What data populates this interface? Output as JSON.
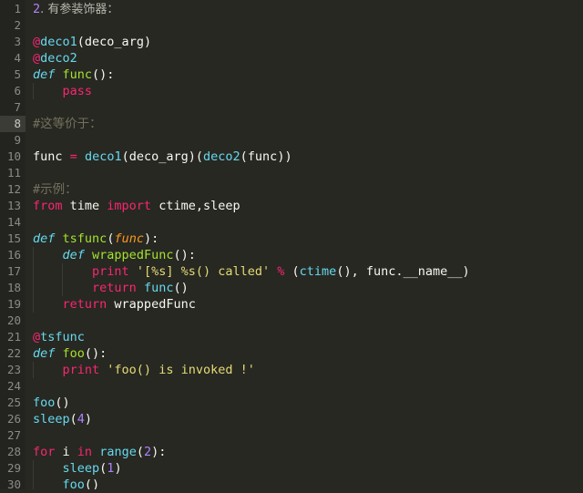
{
  "editor": {
    "name": "code-editor",
    "theme": "monokai-dark",
    "language": "python",
    "colors": {
      "background": "#272822",
      "gutter_background": "#232420",
      "gutter_text": "#8a8b85",
      "active_line_gutter_background": "#3b3c35",
      "keyword": "#f92672",
      "definition": "#66d9ef",
      "function_name": "#a6e22e",
      "parameter": "#fd971f",
      "number": "#ae81ff",
      "string": "#e6db74",
      "comment": "#75715e",
      "plain_text": "#f8f8f2",
      "indent_guide": "#3a3b34"
    },
    "active_line": 8,
    "first_line": 1,
    "last_line": 30,
    "total_visible_lines": 30
  },
  "gutter": {
    "line_numbers": [
      "1",
      "2",
      "3",
      "4",
      "5",
      "6",
      "7",
      "8",
      "9",
      "10",
      "11",
      "12",
      "13",
      "14",
      "15",
      "16",
      "17",
      "18",
      "19",
      "20",
      "21",
      "22",
      "23",
      "24",
      "25",
      "26",
      "27",
      "28",
      "29",
      "30"
    ]
  },
  "lines": [
    {
      "n": 1,
      "indent": 0,
      "plain": "2. 有参装饰器：",
      "tokens": [
        {
          "t": "2",
          "c": "t-num"
        },
        {
          "t": ". ",
          "c": "t-cjk"
        },
        {
          "t": "有参装饰器：",
          "c": "t-cjk"
        }
      ]
    },
    {
      "n": 2,
      "indent": 0,
      "plain": "",
      "tokens": []
    },
    {
      "n": 3,
      "indent": 0,
      "plain": "@deco1(deco_arg)",
      "tokens": [
        {
          "t": "@",
          "c": "t-at"
        },
        {
          "t": "deco1",
          "c": "t-call"
        },
        {
          "t": "(",
          "c": "t-punct"
        },
        {
          "t": "deco_arg",
          "c": "t-plain"
        },
        {
          "t": ")",
          "c": "t-punct"
        }
      ]
    },
    {
      "n": 4,
      "indent": 0,
      "plain": "@deco2",
      "tokens": [
        {
          "t": "@",
          "c": "t-at"
        },
        {
          "t": "deco2",
          "c": "t-call"
        }
      ]
    },
    {
      "n": 5,
      "indent": 0,
      "plain": "def func():",
      "tokens": [
        {
          "t": "def",
          "c": "t-def"
        },
        {
          "t": " ",
          "c": "t-plain"
        },
        {
          "t": "func",
          "c": "t-fn"
        },
        {
          "t": "():",
          "c": "t-punct"
        }
      ]
    },
    {
      "n": 6,
      "indent": 1,
      "plain": "    pass",
      "tokens": [
        {
          "t": "    ",
          "c": "t-plain"
        },
        {
          "t": "pass",
          "c": "t-kw"
        }
      ]
    },
    {
      "n": 7,
      "indent": 0,
      "plain": "",
      "tokens": []
    },
    {
      "n": 8,
      "indent": 0,
      "plain": "#这等价于：",
      "tokens": [
        {
          "t": "#",
          "c": "t-cmt"
        },
        {
          "t": "这等价于：",
          "c": "t-cmt t-cjk-c"
        }
      ]
    },
    {
      "n": 9,
      "indent": 0,
      "plain": "",
      "tokens": []
    },
    {
      "n": 10,
      "indent": 0,
      "plain": "func = deco1(deco_arg)(deco2(func))",
      "tokens": [
        {
          "t": "func",
          "c": "t-plain"
        },
        {
          "t": " ",
          "c": "t-plain"
        },
        {
          "t": "=",
          "c": "t-kw"
        },
        {
          "t": " ",
          "c": "t-plain"
        },
        {
          "t": "deco1",
          "c": "t-call"
        },
        {
          "t": "(",
          "c": "t-punct"
        },
        {
          "t": "deco_arg",
          "c": "t-plain"
        },
        {
          "t": ")(",
          "c": "t-punct"
        },
        {
          "t": "deco2",
          "c": "t-call"
        },
        {
          "t": "(",
          "c": "t-punct"
        },
        {
          "t": "func",
          "c": "t-plain"
        },
        {
          "t": "))",
          "c": "t-punct"
        }
      ]
    },
    {
      "n": 11,
      "indent": 0,
      "plain": "",
      "tokens": []
    },
    {
      "n": 12,
      "indent": 0,
      "plain": "#示例：",
      "tokens": [
        {
          "t": "#",
          "c": "t-cmt"
        },
        {
          "t": "示例：",
          "c": "t-cmt t-cjk-c"
        }
      ]
    },
    {
      "n": 13,
      "indent": 0,
      "plain": "from time import ctime,sleep",
      "tokens": [
        {
          "t": "from",
          "c": "t-kw"
        },
        {
          "t": " time ",
          "c": "t-plain"
        },
        {
          "t": "import",
          "c": "t-kw"
        },
        {
          "t": " ctime,sleep",
          "c": "t-plain"
        }
      ]
    },
    {
      "n": 14,
      "indent": 0,
      "plain": "",
      "tokens": []
    },
    {
      "n": 15,
      "indent": 0,
      "plain": "def tsfunc(func):",
      "tokens": [
        {
          "t": "def",
          "c": "t-def"
        },
        {
          "t": " ",
          "c": "t-plain"
        },
        {
          "t": "tsfunc",
          "c": "t-fn"
        },
        {
          "t": "(",
          "c": "t-punct"
        },
        {
          "t": "func",
          "c": "t-param"
        },
        {
          "t": "):",
          "c": "t-punct"
        }
      ]
    },
    {
      "n": 16,
      "indent": 1,
      "plain": "    def wrappedFunc():",
      "tokens": [
        {
          "t": "    ",
          "c": "t-plain"
        },
        {
          "t": "def",
          "c": "t-def"
        },
        {
          "t": " ",
          "c": "t-plain"
        },
        {
          "t": "wrappedFunc",
          "c": "t-fn"
        },
        {
          "t": "():",
          "c": "t-punct"
        }
      ]
    },
    {
      "n": 17,
      "indent": 2,
      "plain": "        print '[%s] %s() called' % (ctime(), func.__name__)",
      "tokens": [
        {
          "t": "        ",
          "c": "t-plain"
        },
        {
          "t": "print",
          "c": "t-kw"
        },
        {
          "t": " ",
          "c": "t-plain"
        },
        {
          "t": "'[%s] %s() called'",
          "c": "t-str"
        },
        {
          "t": " ",
          "c": "t-plain"
        },
        {
          "t": "%",
          "c": "t-kw"
        },
        {
          "t": " (",
          "c": "t-punct"
        },
        {
          "t": "ctime",
          "c": "t-call"
        },
        {
          "t": "(), ",
          "c": "t-punct"
        },
        {
          "t": "func.__name__",
          "c": "t-plain"
        },
        {
          "t": ")",
          "c": "t-punct"
        }
      ]
    },
    {
      "n": 18,
      "indent": 2,
      "plain": "        return func()",
      "tokens": [
        {
          "t": "        ",
          "c": "t-plain"
        },
        {
          "t": "return",
          "c": "t-kw"
        },
        {
          "t": " ",
          "c": "t-plain"
        },
        {
          "t": "func",
          "c": "t-call"
        },
        {
          "t": "()",
          "c": "t-punct"
        }
      ]
    },
    {
      "n": 19,
      "indent": 1,
      "plain": "    return wrappedFunc",
      "tokens": [
        {
          "t": "    ",
          "c": "t-plain"
        },
        {
          "t": "return",
          "c": "t-kw"
        },
        {
          "t": " wrappedFunc",
          "c": "t-plain"
        }
      ]
    },
    {
      "n": 20,
      "indent": 0,
      "plain": "",
      "tokens": []
    },
    {
      "n": 21,
      "indent": 0,
      "plain": "@tsfunc",
      "tokens": [
        {
          "t": "@",
          "c": "t-at"
        },
        {
          "t": "tsfunc",
          "c": "t-call"
        }
      ]
    },
    {
      "n": 22,
      "indent": 0,
      "plain": "def foo():",
      "tokens": [
        {
          "t": "def",
          "c": "t-def"
        },
        {
          "t": " ",
          "c": "t-plain"
        },
        {
          "t": "foo",
          "c": "t-fn"
        },
        {
          "t": "():",
          "c": "t-punct"
        }
      ]
    },
    {
      "n": 23,
      "indent": 1,
      "plain": "    print 'foo() is invoked !'",
      "tokens": [
        {
          "t": "    ",
          "c": "t-plain"
        },
        {
          "t": "print",
          "c": "t-kw"
        },
        {
          "t": " ",
          "c": "t-plain"
        },
        {
          "t": "'foo() is invoked !'",
          "c": "t-str"
        }
      ]
    },
    {
      "n": 24,
      "indent": 0,
      "plain": "",
      "tokens": []
    },
    {
      "n": 25,
      "indent": 0,
      "plain": "foo()",
      "tokens": [
        {
          "t": "foo",
          "c": "t-call"
        },
        {
          "t": "()",
          "c": "t-punct"
        }
      ]
    },
    {
      "n": 26,
      "indent": 0,
      "plain": "sleep(4)",
      "tokens": [
        {
          "t": "sleep",
          "c": "t-call"
        },
        {
          "t": "(",
          "c": "t-punct"
        },
        {
          "t": "4",
          "c": "t-num"
        },
        {
          "t": ")",
          "c": "t-punct"
        }
      ]
    },
    {
      "n": 27,
      "indent": 0,
      "plain": "",
      "tokens": []
    },
    {
      "n": 28,
      "indent": 0,
      "plain": "for i in range(2):",
      "tokens": [
        {
          "t": "for",
          "c": "t-kw"
        },
        {
          "t": " i ",
          "c": "t-plain"
        },
        {
          "t": "in",
          "c": "t-kw"
        },
        {
          "t": " ",
          "c": "t-plain"
        },
        {
          "t": "range",
          "c": "t-call"
        },
        {
          "t": "(",
          "c": "t-punct"
        },
        {
          "t": "2",
          "c": "t-num"
        },
        {
          "t": "):",
          "c": "t-punct"
        }
      ]
    },
    {
      "n": 29,
      "indent": 1,
      "plain": "    sleep(1)",
      "tokens": [
        {
          "t": "    ",
          "c": "t-plain"
        },
        {
          "t": "sleep",
          "c": "t-call"
        },
        {
          "t": "(",
          "c": "t-punct"
        },
        {
          "t": "1",
          "c": "t-num"
        },
        {
          "t": ")",
          "c": "t-punct"
        }
      ]
    },
    {
      "n": 30,
      "indent": 1,
      "plain": "    foo()",
      "tokens": [
        {
          "t": "    ",
          "c": "t-plain"
        },
        {
          "t": "foo",
          "c": "t-call"
        },
        {
          "t": "()",
          "c": "t-punct"
        }
      ]
    }
  ]
}
